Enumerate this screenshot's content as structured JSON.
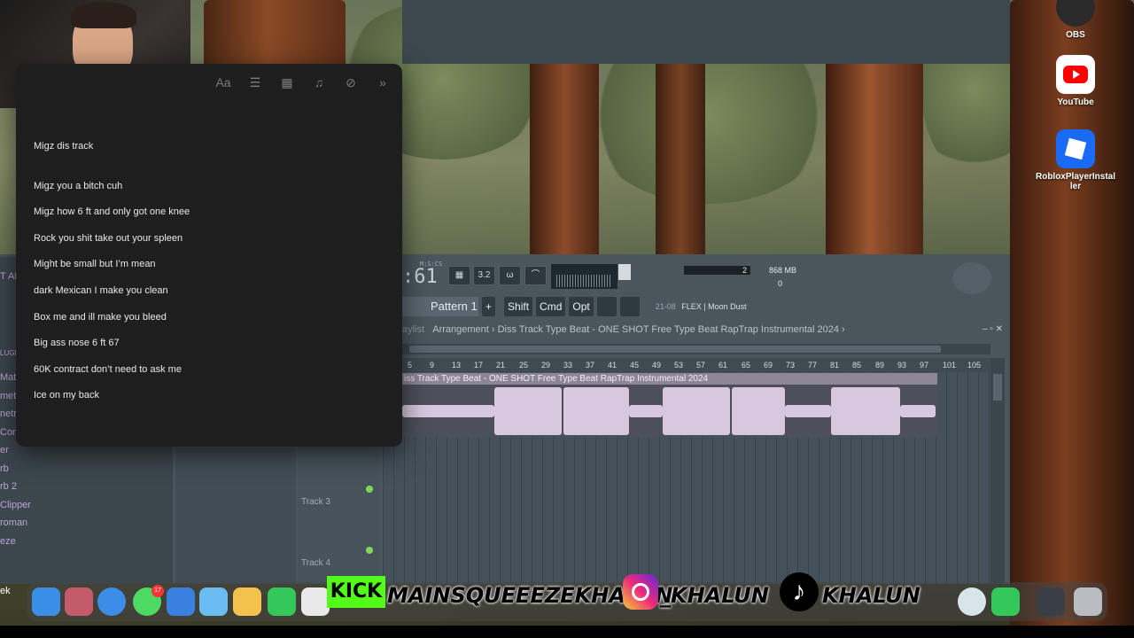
{
  "notes": {
    "toolbar": [
      "Aa",
      "☰",
      "▦",
      "♫",
      "⊘",
      "»"
    ],
    "lines": [
      "Migz dis track",
      "Migz you a bitch cuh",
      "Migz how 6 ft and only got one knee",
      "Rock you shit take out your spleen",
      "Might be small but I’m mean",
      "dark Mexican I make you clean",
      "Box me and ill make you bleed",
      "Big ass nose 6 ft 67",
      "60K contract don’t need to ask me",
      "Ice on my back"
    ]
  },
  "desktop": {
    "obs": "OBS",
    "youtube": "YouTube",
    "roblox": "RobloxPlayerInstal ler"
  },
  "fl": {
    "clock": ":61",
    "clock_label": "M:S:CS",
    "tools": [
      "▦",
      "3.2",
      "ω",
      "⌒"
    ],
    "cpu_num": "2",
    "mem": "868 MB",
    "polyphony": "0",
    "pattern": "Pattern 1",
    "plus": "+",
    "shift": "Shift",
    "cmd": "Cmd",
    "opt": "Opt",
    "hint_num": "21-08",
    "hint_text": "FLEX | Moon Dust",
    "playlist_prefix": "aylist",
    "playlist_path": "Arrangement › Diss Track Type Beat - ONE SHOT  Free Type Beat  RapTrap Instrumental 2024 ›",
    "window_buttons": "‒  ▫  ✕",
    "ruler": [
      "5",
      "9",
      "13",
      "17",
      "21",
      "25",
      "29",
      "33",
      "37",
      "41",
      "45",
      "49",
      "53",
      "57",
      "61",
      "65",
      "69",
      "73",
      "77",
      "81",
      "85",
      "89",
      "93",
      "97",
      "101",
      "105"
    ],
    "clip_title": "iss Track Type Beat - ONE SHOT  Free Type Beat  RapTrap Instrumental 2024",
    "track3": "Track 3",
    "track4": "Track 4",
    "left_items": [
      "T AD",
      "LUGI",
      "Mat",
      "metr",
      "netr",
      "Con",
      "er",
      "rb",
      "rb 2",
      "Clipper",
      "roman",
      "eze"
    ]
  },
  "overlay": {
    "kick": "KICK",
    "kick_handle": "MAINSQUEEEZEKHALUN",
    "ig_handle": "_KHALUN",
    "tt_handle": "KHALUN",
    "tt_glyph": "♪",
    "left_label": "ek",
    "notes_badge": "17"
  }
}
